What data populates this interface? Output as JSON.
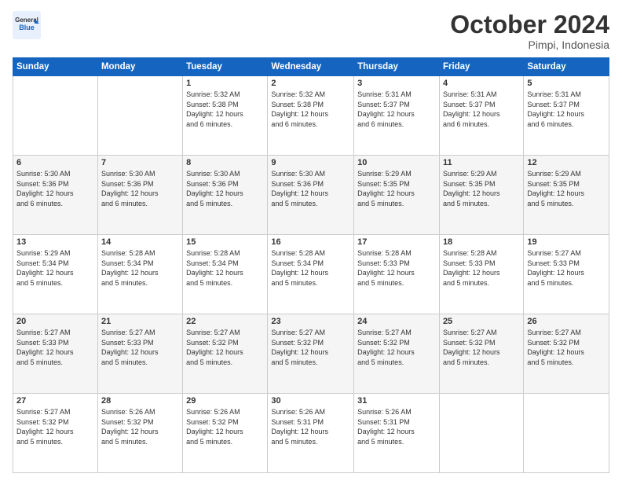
{
  "logo": {
    "line1": "General",
    "line2": "Blue"
  },
  "title": {
    "month_year": "October 2024",
    "location": "Pimpi, Indonesia"
  },
  "weekdays": [
    "Sunday",
    "Monday",
    "Tuesday",
    "Wednesday",
    "Thursday",
    "Friday",
    "Saturday"
  ],
  "weeks": [
    [
      {
        "day": "",
        "info": ""
      },
      {
        "day": "",
        "info": ""
      },
      {
        "day": "1",
        "info": "Sunrise: 5:32 AM\nSunset: 5:38 PM\nDaylight: 12 hours\nand 6 minutes."
      },
      {
        "day": "2",
        "info": "Sunrise: 5:32 AM\nSunset: 5:38 PM\nDaylight: 12 hours\nand 6 minutes."
      },
      {
        "day": "3",
        "info": "Sunrise: 5:31 AM\nSunset: 5:37 PM\nDaylight: 12 hours\nand 6 minutes."
      },
      {
        "day": "4",
        "info": "Sunrise: 5:31 AM\nSunset: 5:37 PM\nDaylight: 12 hours\nand 6 minutes."
      },
      {
        "day": "5",
        "info": "Sunrise: 5:31 AM\nSunset: 5:37 PM\nDaylight: 12 hours\nand 6 minutes."
      }
    ],
    [
      {
        "day": "6",
        "info": "Sunrise: 5:30 AM\nSunset: 5:36 PM\nDaylight: 12 hours\nand 6 minutes."
      },
      {
        "day": "7",
        "info": "Sunrise: 5:30 AM\nSunset: 5:36 PM\nDaylight: 12 hours\nand 6 minutes."
      },
      {
        "day": "8",
        "info": "Sunrise: 5:30 AM\nSunset: 5:36 PM\nDaylight: 12 hours\nand 5 minutes."
      },
      {
        "day": "9",
        "info": "Sunrise: 5:30 AM\nSunset: 5:36 PM\nDaylight: 12 hours\nand 5 minutes."
      },
      {
        "day": "10",
        "info": "Sunrise: 5:29 AM\nSunset: 5:35 PM\nDaylight: 12 hours\nand 5 minutes."
      },
      {
        "day": "11",
        "info": "Sunrise: 5:29 AM\nSunset: 5:35 PM\nDaylight: 12 hours\nand 5 minutes."
      },
      {
        "day": "12",
        "info": "Sunrise: 5:29 AM\nSunset: 5:35 PM\nDaylight: 12 hours\nand 5 minutes."
      }
    ],
    [
      {
        "day": "13",
        "info": "Sunrise: 5:29 AM\nSunset: 5:34 PM\nDaylight: 12 hours\nand 5 minutes."
      },
      {
        "day": "14",
        "info": "Sunrise: 5:28 AM\nSunset: 5:34 PM\nDaylight: 12 hours\nand 5 minutes."
      },
      {
        "day": "15",
        "info": "Sunrise: 5:28 AM\nSunset: 5:34 PM\nDaylight: 12 hours\nand 5 minutes."
      },
      {
        "day": "16",
        "info": "Sunrise: 5:28 AM\nSunset: 5:34 PM\nDaylight: 12 hours\nand 5 minutes."
      },
      {
        "day": "17",
        "info": "Sunrise: 5:28 AM\nSunset: 5:33 PM\nDaylight: 12 hours\nand 5 minutes."
      },
      {
        "day": "18",
        "info": "Sunrise: 5:28 AM\nSunset: 5:33 PM\nDaylight: 12 hours\nand 5 minutes."
      },
      {
        "day": "19",
        "info": "Sunrise: 5:27 AM\nSunset: 5:33 PM\nDaylight: 12 hours\nand 5 minutes."
      }
    ],
    [
      {
        "day": "20",
        "info": "Sunrise: 5:27 AM\nSunset: 5:33 PM\nDaylight: 12 hours\nand 5 minutes."
      },
      {
        "day": "21",
        "info": "Sunrise: 5:27 AM\nSunset: 5:33 PM\nDaylight: 12 hours\nand 5 minutes."
      },
      {
        "day": "22",
        "info": "Sunrise: 5:27 AM\nSunset: 5:32 PM\nDaylight: 12 hours\nand 5 minutes."
      },
      {
        "day": "23",
        "info": "Sunrise: 5:27 AM\nSunset: 5:32 PM\nDaylight: 12 hours\nand 5 minutes."
      },
      {
        "day": "24",
        "info": "Sunrise: 5:27 AM\nSunset: 5:32 PM\nDaylight: 12 hours\nand 5 minutes."
      },
      {
        "day": "25",
        "info": "Sunrise: 5:27 AM\nSunset: 5:32 PM\nDaylight: 12 hours\nand 5 minutes."
      },
      {
        "day": "26",
        "info": "Sunrise: 5:27 AM\nSunset: 5:32 PM\nDaylight: 12 hours\nand 5 minutes."
      }
    ],
    [
      {
        "day": "27",
        "info": "Sunrise: 5:27 AM\nSunset: 5:32 PM\nDaylight: 12 hours\nand 5 minutes."
      },
      {
        "day": "28",
        "info": "Sunrise: 5:26 AM\nSunset: 5:32 PM\nDaylight: 12 hours\nand 5 minutes."
      },
      {
        "day": "29",
        "info": "Sunrise: 5:26 AM\nSunset: 5:32 PM\nDaylight: 12 hours\nand 5 minutes."
      },
      {
        "day": "30",
        "info": "Sunrise: 5:26 AM\nSunset: 5:31 PM\nDaylight: 12 hours\nand 5 minutes."
      },
      {
        "day": "31",
        "info": "Sunrise: 5:26 AM\nSunset: 5:31 PM\nDaylight: 12 hours\nand 5 minutes."
      },
      {
        "day": "",
        "info": ""
      },
      {
        "day": "",
        "info": ""
      }
    ]
  ]
}
